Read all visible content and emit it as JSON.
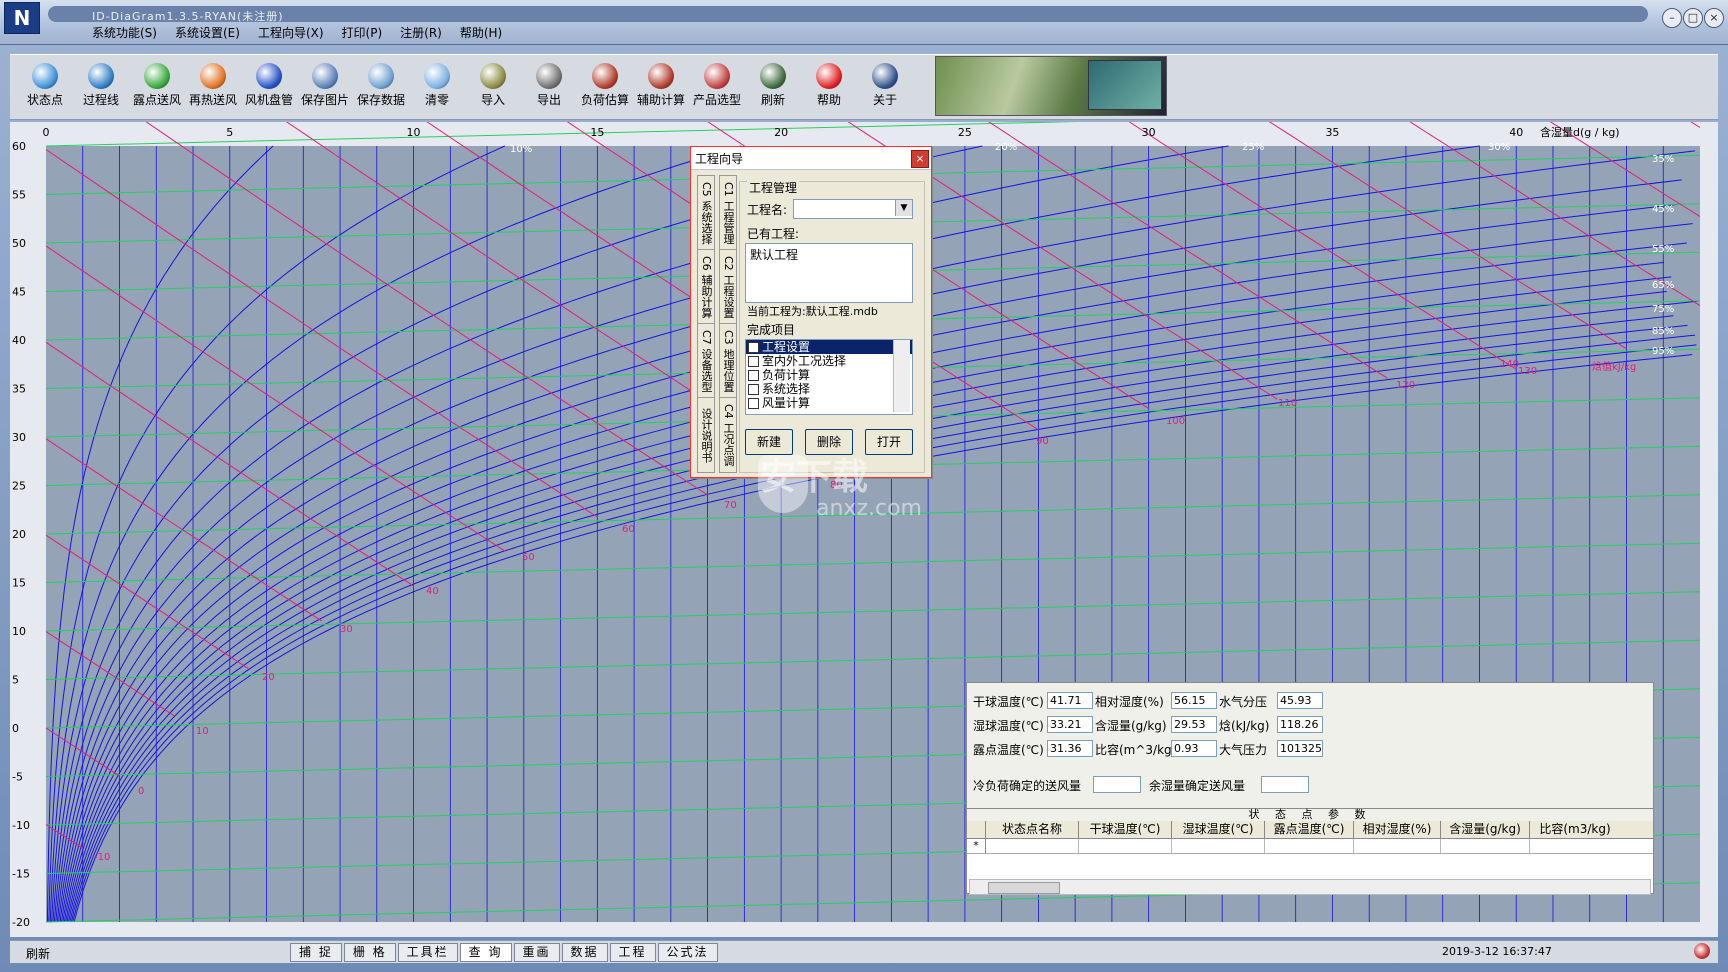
{
  "window": {
    "title": "ID-DiaGram1.3.5-RYAN(未注册)",
    "logo": "N",
    "buttons": {
      "minimize": "–",
      "restore": "□",
      "close": "×"
    }
  },
  "menu": [
    "系统功能(S)",
    "系统设置(E)",
    "工程向导(X)",
    "打印(P)",
    "注册(R)",
    "帮助(H)"
  ],
  "toolbar": [
    {
      "label": "状态点",
      "icon": "state-point-icon",
      "color": "#3c8fd8"
    },
    {
      "label": "过程线",
      "icon": "process-line-icon",
      "color": "#2f7dc4"
    },
    {
      "label": "露点送风",
      "icon": "dewpoint-supply-icon",
      "color": "#35a83a"
    },
    {
      "label": "再热送风",
      "icon": "reheat-supply-icon",
      "color": "#e07020"
    },
    {
      "label": "风机盘管",
      "icon": "fan-coil-icon",
      "color": "#2451c8"
    },
    {
      "label": "保存图片",
      "icon": "save-image-icon",
      "color": "#5a7fb8"
    },
    {
      "label": "保存数据",
      "icon": "save-data-icon",
      "color": "#6fa0d0"
    },
    {
      "label": "清零",
      "icon": "clear-icon",
      "color": "#7db0e0"
    },
    {
      "label": "导入",
      "icon": "import-icon",
      "color": "#8a8a40"
    },
    {
      "label": "导出",
      "icon": "export-icon",
      "color": "#707070"
    },
    {
      "label": "负荷估算",
      "icon": "load-estimate-icon",
      "color": "#b03a2a"
    },
    {
      "label": "辅助计算",
      "icon": "aux-calc-icon",
      "color": "#b03a2a"
    },
    {
      "label": "产品选型",
      "icon": "product-select-icon",
      "color": "#c04040"
    },
    {
      "label": "刷新",
      "icon": "refresh-icon",
      "color": "#3d6a3d"
    },
    {
      "label": "帮助",
      "icon": "help-icon",
      "color": "#e02020"
    },
    {
      "label": "关于",
      "icon": "about-icon",
      "color": "#30508a"
    }
  ],
  "chart_data": {
    "type": "line",
    "title": "",
    "xlabel": "含湿量d(g / kg)",
    "ylabel": "",
    "xlim": [
      0,
      45
    ],
    "ylim": [
      -20,
      60
    ],
    "x_ticks": [
      "0",
      "5",
      "10",
      "15",
      "20",
      "25",
      "30",
      "35",
      "40"
    ],
    "y_ticks": [
      "60",
      "55",
      "50",
      "45",
      "40",
      "35",
      "30",
      "25",
      "20",
      "15",
      "10",
      "5",
      "0",
      "-5",
      "-10",
      "-15",
      "-20"
    ],
    "rh_labels": [
      "10%",
      "20%",
      "25%",
      "30%",
      "35%",
      "45%",
      "55%",
      "65%",
      "75%",
      "85%",
      "95%"
    ],
    "enthalpy_labels": [
      "-10",
      "0",
      "10",
      "20",
      "30",
      "40",
      "50",
      "60",
      "70",
      "80",
      "90",
      "100",
      "110",
      "120",
      "130",
      "140"
    ],
    "enthalpy_unit": "焓值kJ/kg",
    "grid": true,
    "colors": {
      "background": "#95a3b6",
      "rh_lines": "#1414e0",
      "enthalpy_lines": "#e0207a",
      "temp_lines": "#22d060",
      "label_pink": "#e0207a"
    }
  },
  "dialog": {
    "title": "工程向导",
    "close": "×",
    "vertical_tabs": [
      "C1 工程管理",
      "C5 系统选择",
      "C2 工程设置",
      "C6 辅助计算",
      "C3 地理位置",
      "C7 设备选型",
      "C4 工况点调",
      "设计说明书"
    ],
    "group_title": "工程管理",
    "project_name_label": "工程名:",
    "project_name_value": "",
    "existing_label": "已有工程:",
    "existing_items": [
      "默认工程"
    ],
    "current_project": "当前工程为:默认工程.mdb",
    "completed_label": "完成项目",
    "completed_items": [
      {
        "label": "工程设置",
        "checked": false,
        "selected": true
      },
      {
        "label": "室内外工况选择",
        "checked": false,
        "selected": false
      },
      {
        "label": "负荷计算",
        "checked": false,
        "selected": false
      },
      {
        "label": "系统选择",
        "checked": false,
        "selected": false
      },
      {
        "label": "风量计算",
        "checked": false,
        "selected": false
      }
    ],
    "buttons": {
      "new": "新建",
      "delete": "删除",
      "open": "打开"
    }
  },
  "state_panel": {
    "rows": [
      [
        {
          "label": "干球温度(℃)",
          "value": "41.71"
        },
        {
          "label": "相对湿度(%)",
          "value": "56.15"
        },
        {
          "label": "水气分压",
          "value": "45.93"
        }
      ],
      [
        {
          "label": "湿球温度(℃)",
          "value": "33.21"
        },
        {
          "label": "含湿量(g/kg)",
          "value": "29.53"
        },
        {
          "label": "焓(kJ/kg)",
          "value": "118.26"
        }
      ],
      [
        {
          "label": "露点温度(℃)",
          "value": "31.36"
        },
        {
          "label": "比容(m^3/kg)",
          "value": "0.93"
        },
        {
          "label": "大气压力",
          "value": "101325"
        }
      ]
    ],
    "load_airflow_label": "冷负荷确定的送风量",
    "load_airflow_value": "",
    "moisture_airflow_label": "余湿量确定送风量",
    "moisture_airflow_value": ""
  },
  "state_grid": {
    "title": "状 态 点 参 数",
    "columns": [
      "状态点名称",
      "干球温度(℃)",
      "湿球温度(℃)",
      "露点温度(℃)",
      "相对湿度(%)",
      "含湿量(g/kg)",
      "比容(m3/kg)"
    ],
    "new_row_marker": "*"
  },
  "statusbar": {
    "left": "刷新",
    "tabs": [
      "捕 捉",
      "栅 格",
      "工具栏",
      "查 询",
      "重画",
      "数据",
      "工程",
      "公式法"
    ],
    "time": "2019-3-12 16:37:47"
  },
  "watermark": {
    "text": "安下载",
    "sub": "anxz.com"
  }
}
